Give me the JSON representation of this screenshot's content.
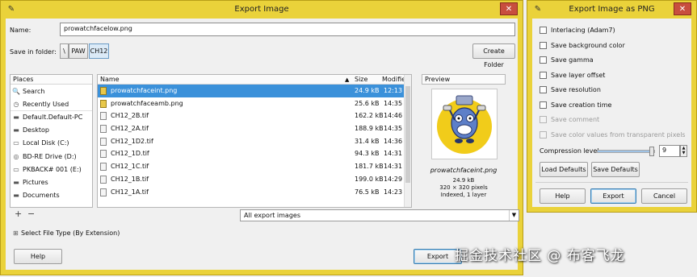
{
  "export_dialog": {
    "title": "Export Image",
    "name_label": "Name:",
    "name_value": "prowatchfacelow.png",
    "save_in_label": "Save in folder:",
    "path_segments": [
      "\\",
      "PAW",
      "CH12"
    ],
    "create_folder": "Create Folder",
    "places_header": "Places",
    "places": [
      {
        "label": "Search",
        "icon": "search-icon"
      },
      {
        "label": "Recently Used",
        "icon": "clock-icon"
      },
      {
        "label": "Default.Default-PC",
        "icon": "folder-icon"
      },
      {
        "label": "Desktop",
        "icon": "folder-icon"
      },
      {
        "label": "Local Disk (C:)",
        "icon": "drive-icon"
      },
      {
        "label": "BD-RE Drive (D:)",
        "icon": "disc-icon"
      },
      {
        "label": "PKBACK# 001 (E:)",
        "icon": "drive-icon"
      },
      {
        "label": "Pictures",
        "icon": "folder-icon"
      },
      {
        "label": "Documents",
        "icon": "folder-icon"
      }
    ],
    "columns": {
      "name": "Name",
      "size": "Size",
      "modified": "Modified"
    },
    "files": [
      {
        "name": "prowatchfaceint.png",
        "size": "24.9 kB",
        "modified": "12:13",
        "type": "png",
        "selected": true
      },
      {
        "name": "prowatchfaceamb.png",
        "size": "25.6 kB",
        "modified": "14:35",
        "type": "png"
      },
      {
        "name": "CH12_2B.tif",
        "size": "162.2 kB",
        "modified": "14:46",
        "type": "tif"
      },
      {
        "name": "CH12_2A.tif",
        "size": "188.9 kB",
        "modified": "14:35",
        "type": "tif"
      },
      {
        "name": "CH12_1D2.tif",
        "size": "31.4 kB",
        "modified": "14:36",
        "type": "tif"
      },
      {
        "name": "CH12_1D.tif",
        "size": "94.3 kB",
        "modified": "14:31",
        "type": "tif"
      },
      {
        "name": "CH12_1C.tif",
        "size": "181.7 kB",
        "modified": "14:31",
        "type": "tif"
      },
      {
        "name": "CH12_1B.tif",
        "size": "199.0 kB",
        "modified": "14:29",
        "type": "tif"
      },
      {
        "name": "CH12_1A.tif",
        "size": "76.5 kB",
        "modified": "14:23",
        "type": "tif"
      }
    ],
    "preview": {
      "header": "Preview",
      "filename": "prowatchfaceint.png",
      "size": "24.9 kB",
      "dims": "320 × 320 pixels",
      "info": "Indexed, 1 layer"
    },
    "add_symbol": "+",
    "remove_symbol": "−",
    "filter_value": "All export images",
    "select_file_type": "Select File Type (By Extension)",
    "help": "Help",
    "export": "Export"
  },
  "png_dialog": {
    "title": "Export Image as PNG",
    "options": [
      {
        "label": "Interlacing (Adam7)",
        "checked": false,
        "enabled": true
      },
      {
        "label": "Save background color",
        "checked": false,
        "enabled": true
      },
      {
        "label": "Save gamma",
        "checked": false,
        "enabled": true
      },
      {
        "label": "Save layer offset",
        "checked": false,
        "enabled": true
      },
      {
        "label": "Save resolution",
        "checked": false,
        "enabled": true
      },
      {
        "label": "Save creation time",
        "checked": false,
        "enabled": true
      },
      {
        "label": "Save comment",
        "checked": false,
        "enabled": false
      },
      {
        "label": "Save color values from transparent pixels",
        "checked": false,
        "enabled": false
      }
    ],
    "compression_label": "Compression level:",
    "compression_value": "9",
    "compression_max": 9,
    "load_defaults": "Load Defaults",
    "save_defaults": "Save Defaults",
    "help": "Help",
    "export": "Export",
    "cancel": "Cancel"
  },
  "watermark": "掘金技术社区 @ 布客飞龙",
  "colors": {
    "title_bar": "#ead23a",
    "selection": "#3b91da",
    "close": "#c84e3e"
  }
}
